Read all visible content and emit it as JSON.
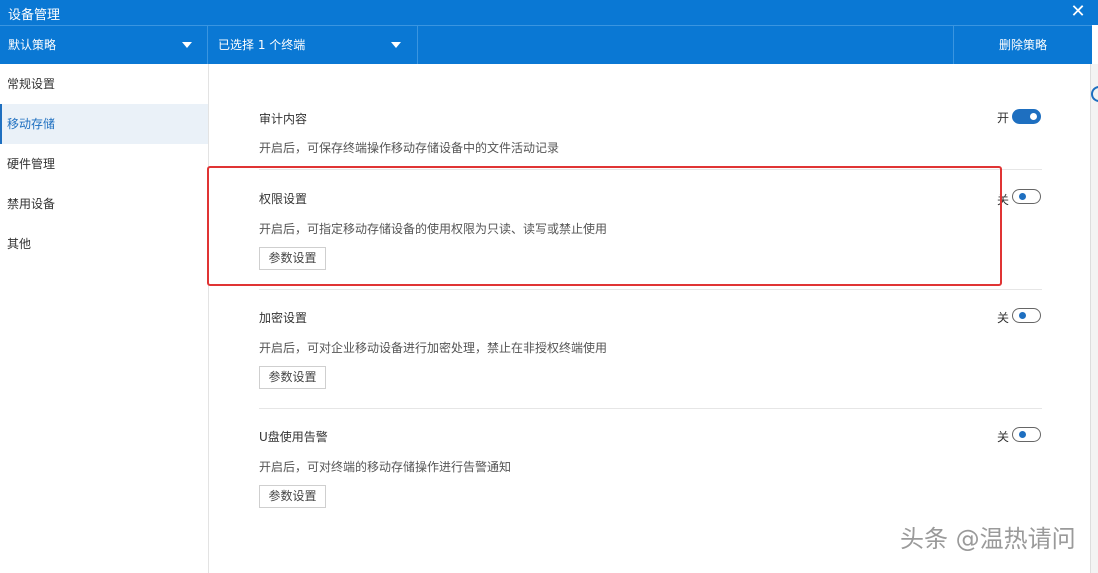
{
  "window": {
    "title": "设备管理",
    "close_glyph": "✕"
  },
  "toolbar": {
    "policy_select": "默认策略",
    "terminal_select": "已选择 1 个终端",
    "delete_label": "删除策略"
  },
  "sidebar": {
    "items": [
      {
        "label": "常规设置",
        "active": false
      },
      {
        "label": "移动存储",
        "active": true
      },
      {
        "label": "硬件管理",
        "active": false
      },
      {
        "label": "禁用设备",
        "active": false
      },
      {
        "label": "其他",
        "active": false
      }
    ]
  },
  "sections": [
    {
      "title": "审计内容",
      "description": "开启后，可保存终端操作移动存储设备中的文件活动记录",
      "switch_label": "开",
      "enabled": true
    },
    {
      "title": "权限设置",
      "description": "开启后，可指定移动存储设备的使用权限为只读、读写或禁止使用",
      "switch_label": "关",
      "enabled": false,
      "button": "参数设置"
    },
    {
      "title": "加密设置",
      "description": "开启后，可对企业移动设备进行加密处理，禁止在非授权终端使用",
      "switch_label": "关",
      "enabled": false,
      "button": "参数设置"
    },
    {
      "title": "U盘使用告警",
      "description": "开启后，可对终端的移动存储操作进行告警通知",
      "switch_label": "关",
      "enabled": false,
      "button": "参数设置"
    }
  ],
  "watermark": "头条 @温热请问",
  "colors": {
    "brand": "#0a78d4",
    "accent": "#1e6fc0",
    "highlight": "#e03434"
  }
}
